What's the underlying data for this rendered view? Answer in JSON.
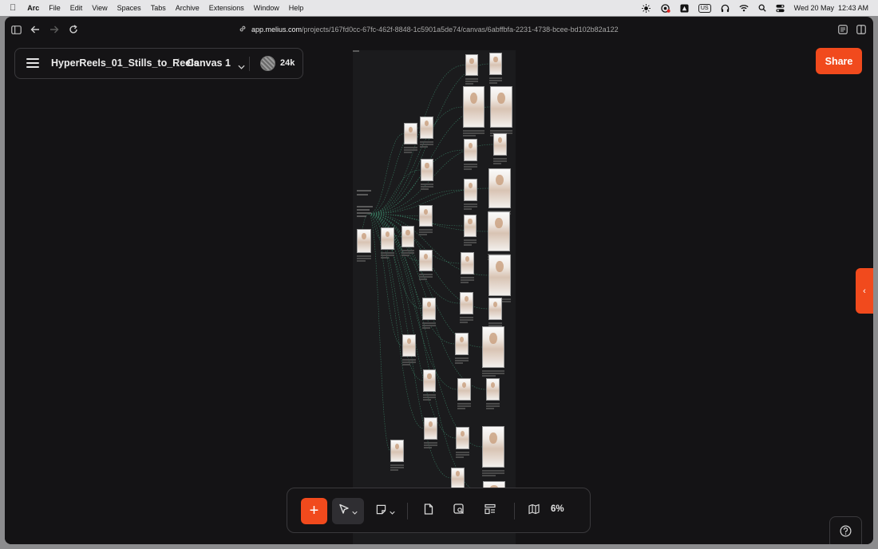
{
  "menubar": {
    "items": [
      "Arc",
      "File",
      "Edit",
      "View",
      "Spaces",
      "Tabs",
      "Archive",
      "Extensions",
      "Window",
      "Help"
    ],
    "keyboard_layout": "US",
    "datetime": "Wed 20 May  12:43 AM"
  },
  "browser": {
    "url_domain": "app.melius.com",
    "url_path": "/projects/167fd0cc-67fc-462f-8848-1c5901a5de74/canvas/6abffbfa-2231-4738-bcee-bd102b82a122"
  },
  "header": {
    "project_name": "HyperReels_01_Stills_to_Reels",
    "separator": "/",
    "canvas_name": "Canvas 1",
    "credits": "24k"
  },
  "share_label": "Share",
  "side_tab_glyph": "‹",
  "toolbar": {
    "add_glyph": "+",
    "zoom": "6%"
  },
  "help_glyph": "?",
  "colors": {
    "accent": "#f14a1d",
    "background": "#141315",
    "board": "#1b1b1d",
    "connector": "#3f8f6f"
  },
  "icons": [
    "apple-icon",
    "sidebar-icon",
    "back-icon",
    "forward-icon",
    "reload-icon",
    "link-icon",
    "menu-icon",
    "chevron-down-icon",
    "cursor-icon",
    "sticky-note-icon",
    "document-icon",
    "image-search-icon",
    "layout-icon",
    "map-icon",
    "help-icon"
  ]
}
